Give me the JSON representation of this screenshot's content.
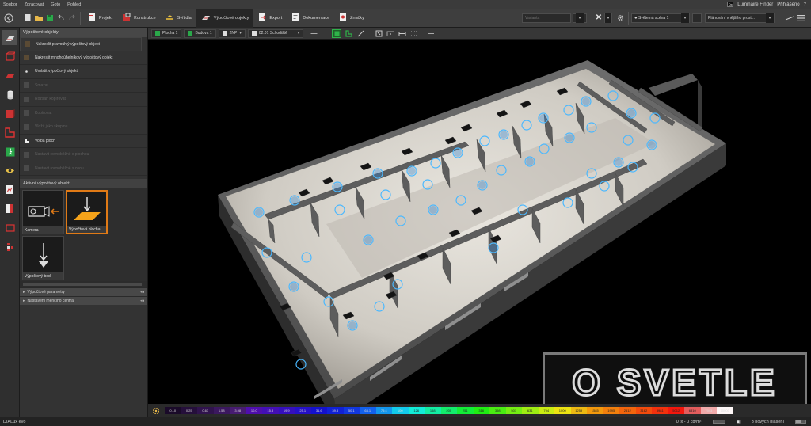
{
  "menu": {
    "items": [
      "Soubor",
      "Zpracovat",
      "Goto",
      "Pohled"
    ],
    "luminaire_finder": "Luminaire Finder",
    "login": "Přihlášeno",
    "dx_badge": "Dx"
  },
  "toolbar": {
    "tabs": [
      {
        "label": "Projekt",
        "icon": "project-icon"
      },
      {
        "label": "Konstrukce",
        "icon": "construction-icon"
      },
      {
        "label": "Svítidla",
        "icon": "luminaire-icon"
      },
      {
        "label": "Výpočtové objekty",
        "icon": "calculation-objects-icon",
        "active": true
      },
      {
        "label": "Export",
        "icon": "export-icon"
      },
      {
        "label": "Dokumentace",
        "icon": "documentation-icon"
      },
      {
        "label": "Značky",
        "icon": "markers-icon"
      }
    ],
    "variant_label": "Varianta",
    "light_scene": "Světelná scéna 1",
    "planning_select": "Plánování vnějšího prost..."
  },
  "panel": {
    "title": "Výpočtové objekty",
    "tools": [
      {
        "label": "Nakreslit pravoúhlý výpočtový objekt",
        "state": "enabled"
      },
      {
        "label": "Nakreslit mnohoúhelníkový výpočtový objekt",
        "state": "enabled"
      },
      {
        "label": "Umístit výpočtový objekt",
        "state": "enabled"
      },
      {
        "label": "Smazat",
        "state": "disabled"
      },
      {
        "label": "Rozsah kopírovat",
        "state": "disabled"
      },
      {
        "label": "Kopírovat",
        "state": "disabled"
      },
      {
        "label": "Vložit jako skupinu",
        "state": "disabled"
      },
      {
        "label": "Volba ploch",
        "state": "enabled"
      },
      {
        "label": "Nastavit rovnoběžně s plochou",
        "state": "disabled"
      },
      {
        "label": "Nastavit rovnoběžně s osou",
        "state": "disabled"
      }
    ],
    "active_object_header": "Aktivní výpočtový objekt",
    "objects": [
      {
        "label": "Kamera"
      },
      {
        "label": "Výpočtová plocha",
        "selected": true
      },
      {
        "label": "Výpočtový bod"
      }
    ],
    "collapsed_sections": [
      "Výpočtové parametry",
      "Nastavení měřicího centra"
    ]
  },
  "viewbar": {
    "crumbs": [
      "Plocha 1",
      "Budova 1",
      "2NP",
      "02.01 Schodiště"
    ]
  },
  "legend": {
    "values": [
      "0.10",
      "0.25",
      "0.63",
      "1.58",
      "3.98",
      "10.0",
      "15.8",
      "19.9",
      "25.1",
      "31.6",
      "39.8",
      "50.1",
      "63.1",
      "79.4",
      "100",
      "126",
      "158",
      "200",
      "251",
      "316",
      "398",
      "501",
      "631",
      "794",
      "1000",
      "1259",
      "1585",
      "1995",
      "2512",
      "3162",
      "3981",
      "5012",
      "6310",
      "7943",
      "10000"
    ]
  },
  "status": {
    "app": "DIALux evo",
    "luminance": "0 lx - 0 cd/m²",
    "messages": "3 nových hlášení"
  },
  "watermark": {
    "text": "O SVETLE"
  }
}
